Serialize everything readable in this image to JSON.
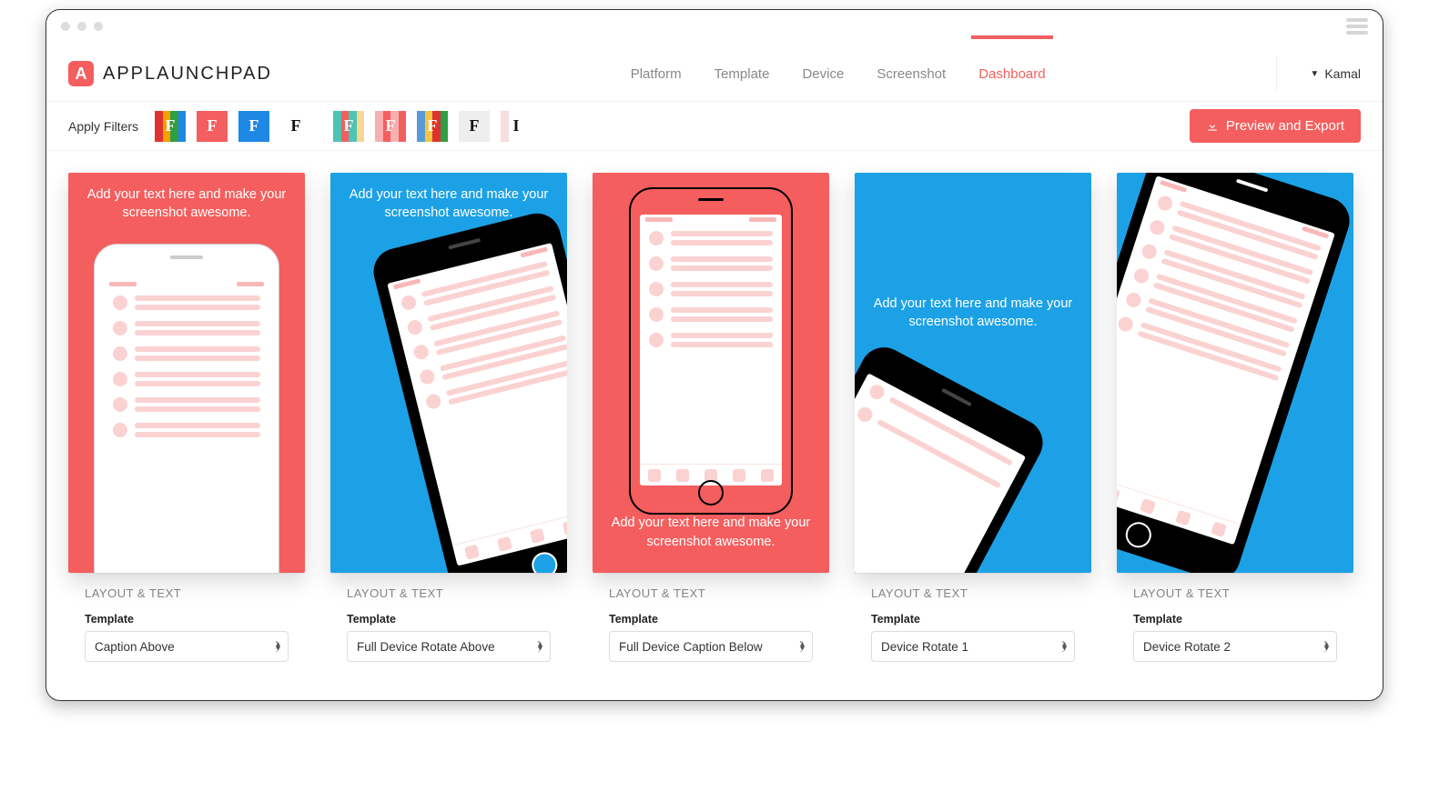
{
  "brand": {
    "logo_letter": "A",
    "name": "APPLAUNCHPAD"
  },
  "nav": {
    "items": [
      "Platform",
      "Template",
      "Device",
      "Screenshot",
      "Dashboard"
    ],
    "active_index": 4
  },
  "user": {
    "name": "Kamal"
  },
  "filters": {
    "label": "Apply Filters",
    "swatches": [
      {
        "stripes": [
          "#e03131",
          "#f59f00",
          "#2f9e44",
          "#1e88e5"
        ],
        "type": "color"
      },
      {
        "stripes": [
          "#f55e5e",
          "#f55e5e",
          "#f55e5e",
          "#f55e5e"
        ],
        "type": "color"
      },
      {
        "stripes": [
          "#1e88e5",
          "#1e88e5",
          "#1e88e5",
          "#1e88e5"
        ],
        "type": "color"
      },
      {
        "stripes": [],
        "type": "plain"
      },
      {
        "stripes": [
          "#4dc4b5",
          "#f55e5e",
          "#4dc4b5",
          "#f7d794"
        ],
        "type": "color",
        "gap": true
      },
      {
        "stripes": [
          "#f7b0b0",
          "#f55e5e",
          "#f7b0b0",
          "#f55e5e"
        ],
        "type": "color"
      },
      {
        "stripes": [
          "#5b9bd5",
          "#f5c542",
          "#e03131",
          "#2f9e44"
        ],
        "type": "color"
      },
      {
        "stripes": [
          "#eee",
          "#eee",
          "#eee",
          "#eee"
        ],
        "type": "light"
      },
      {
        "stripes": [
          "#f7dce0",
          "#fff",
          "#fff",
          "#fff"
        ],
        "type": "light",
        "letter": "I"
      }
    ]
  },
  "buttons": {
    "preview_export": "Preview and Export"
  },
  "cards": [
    {
      "bg": "red",
      "caption": "Add your text here and make your screenshot awesome.",
      "caption_pos": "top",
      "phone": "white-upright",
      "layout_title": "LAYOUT & TEXT",
      "field_label": "Template",
      "template_value": "Caption Above"
    },
    {
      "bg": "blue",
      "caption": "Add your text here and make your screenshot awesome.",
      "caption_pos": "top",
      "phone": "black-rotate-left",
      "layout_title": "LAYOUT & TEXT",
      "field_label": "Template",
      "template_value": "Full Device Rotate Above"
    },
    {
      "bg": "red",
      "caption": "Add your text here and make your screenshot awesome.",
      "caption_pos": "bottom",
      "phone": "outline-upright",
      "layout_title": "LAYOUT & TEXT",
      "field_label": "Template",
      "template_value": "Full Device Caption Below"
    },
    {
      "bg": "blue",
      "caption": "Add your text here and make your screenshot awesome.",
      "caption_pos": "middle",
      "phone": "black-rotate-crop1",
      "layout_title": "LAYOUT & TEXT",
      "field_label": "Template",
      "template_value": "Device Rotate 1"
    },
    {
      "bg": "blue",
      "caption": "",
      "caption_pos": "none",
      "phone": "black-rotate-crop2",
      "layout_title": "LAYOUT & TEXT",
      "field_label": "Template",
      "template_value": "Device Rotate 2"
    }
  ]
}
